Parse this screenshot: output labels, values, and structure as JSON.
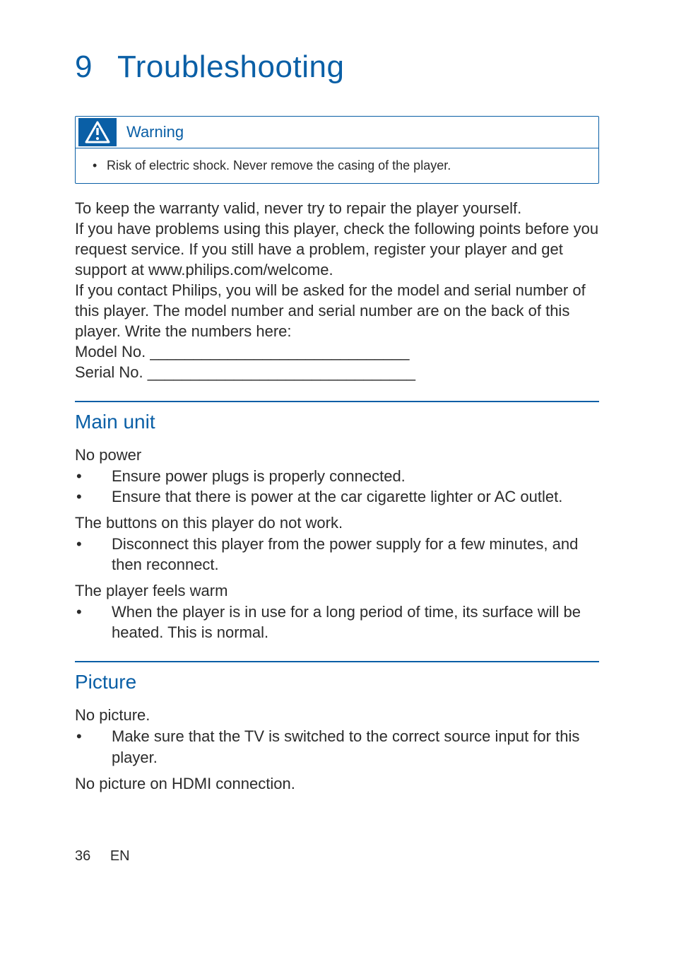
{
  "chapter": {
    "number": "9",
    "title": "Troubleshooting"
  },
  "warning": {
    "label": "Warning",
    "bullet": "Risk of electric shock. Never remove the casing of the player."
  },
  "intro": {
    "p1": "To keep the warranty valid, never try to repair the player yourself.",
    "p2": "If you have problems using this player, check the following points before you request service. If you still have a problem, register your player and get support at www.philips.com/welcome.",
    "p3": "If you contact Philips, you will be asked for the model and serial number of this player. The model number and serial number are on the back of this player. Write the numbers here:",
    "model_line": "Model No. ______________________________",
    "serial_line": "Serial No. _______________________________"
  },
  "sections": {
    "main_unit": {
      "title": "Main unit",
      "subs": [
        {
          "heading": "No power",
          "items": [
            "Ensure power plugs is properly connected.",
            "Ensure that there is power at the car cigarette lighter or AC outlet."
          ]
        },
        {
          "heading": "The buttons on this player do not work.",
          "items": [
            "Disconnect this player from the power supply for a few minutes, and then reconnect."
          ]
        },
        {
          "heading": "The player feels warm",
          "items": [
            "When the player is in use for a long period of time, its surface will be heated.  This is normal."
          ]
        }
      ]
    },
    "picture": {
      "title": "Picture",
      "subs": [
        {
          "heading": "No picture.",
          "items": [
            "Make sure that the TV is switched to the correct source input for this player."
          ]
        },
        {
          "heading": "No picture on HDMI connection.",
          "items": []
        }
      ]
    }
  },
  "footer": {
    "page": "36",
    "lang": "EN"
  }
}
